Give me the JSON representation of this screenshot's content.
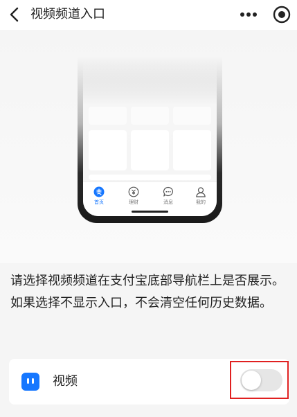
{
  "header": {
    "title": "视频频道入口",
    "back_icon": "chevron-left-icon",
    "more_icon": "more-dots-icon",
    "target_icon": "target-circle-icon"
  },
  "illustration": {
    "tabs": [
      {
        "label": "首页",
        "icon": "alipay-home-icon",
        "active": true
      },
      {
        "label": "理财",
        "icon": "wealth-icon",
        "active": false
      },
      {
        "label": "消息",
        "icon": "chat-icon",
        "active": false
      },
      {
        "label": "我的",
        "icon": "user-icon",
        "active": false
      }
    ]
  },
  "description": "请选择视频频道在支付宝底部导航栏上是否展示。如果选择不显示入口，不会清空任何历史数据。",
  "setting": {
    "label": "视频",
    "icon": "video-app-icon",
    "enabled": false
  },
  "colors": {
    "accent": "#1677ff",
    "highlight": "#e02020",
    "toggle_off": "#e6e6e6"
  }
}
